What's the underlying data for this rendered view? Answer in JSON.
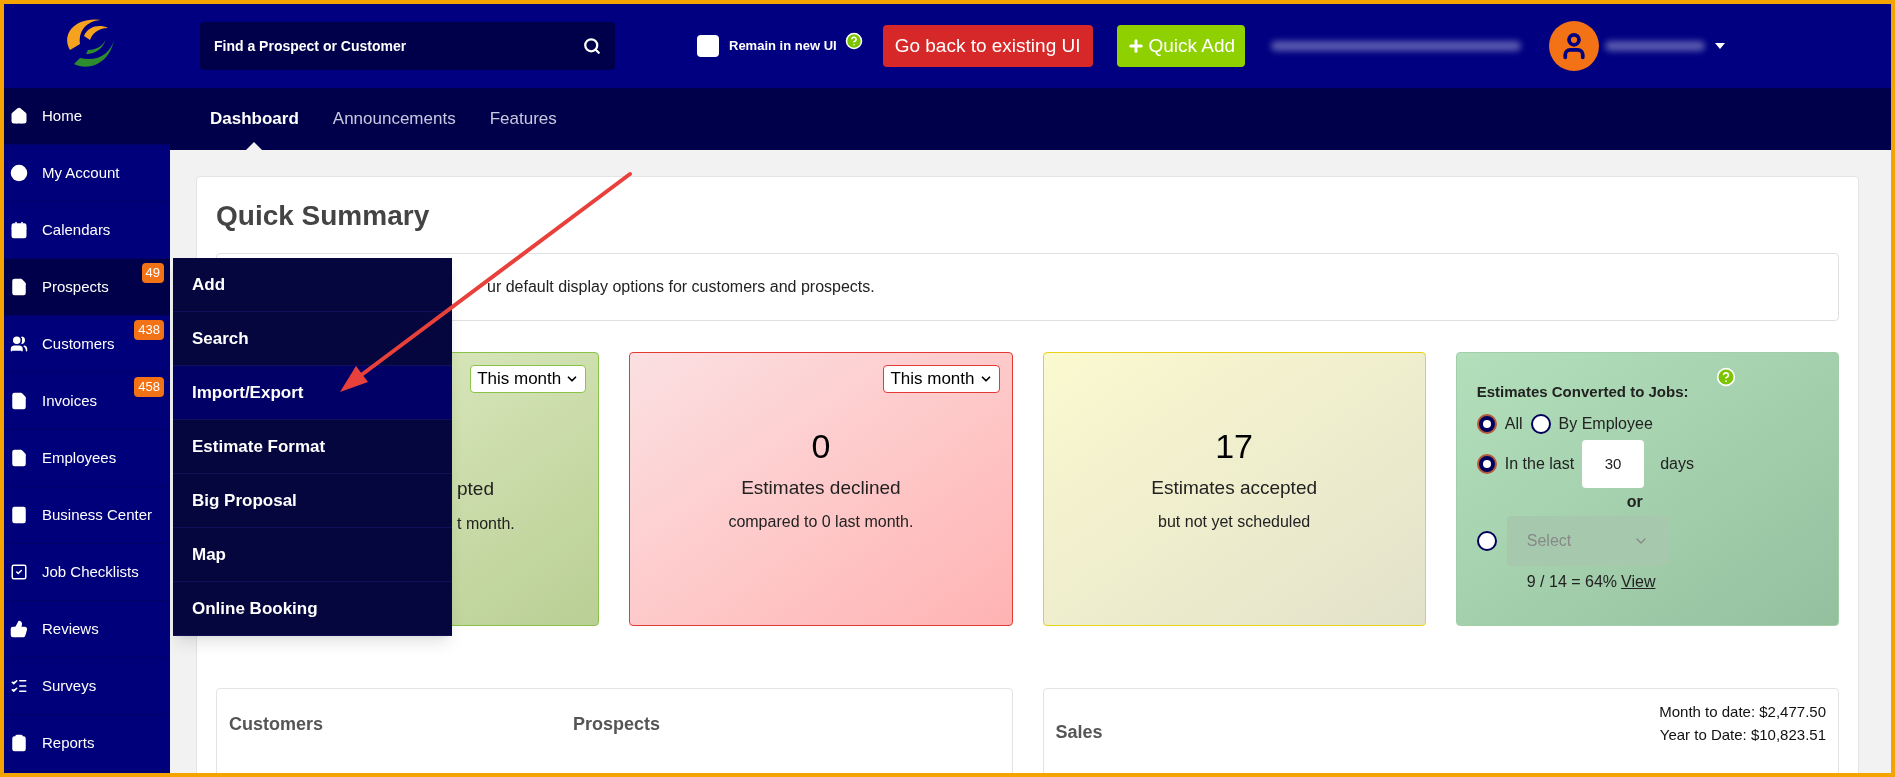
{
  "header": {
    "search": {
      "placeholder": "Find a Prospect or Customer"
    },
    "remain": {
      "label": "Remain in new UI",
      "checked": false
    },
    "back_button": "Go back to existing UI",
    "quick_add": "Quick Add"
  },
  "sidebar": {
    "items": [
      {
        "label": "Home",
        "selected": true
      },
      {
        "label": "My Account",
        "selected": false
      },
      {
        "label": "Calendars",
        "selected": false
      },
      {
        "label": "Prospects",
        "selected": true,
        "badge": "49"
      },
      {
        "label": "Customers",
        "selected": false,
        "badge": "438"
      },
      {
        "label": "Invoices",
        "selected": false,
        "badge": "458"
      },
      {
        "label": "Employees",
        "selected": false
      },
      {
        "label": "Business Center",
        "selected": false
      },
      {
        "label": "Job Checklists",
        "selected": false
      },
      {
        "label": "Reviews",
        "selected": false
      },
      {
        "label": "Surveys",
        "selected": false
      },
      {
        "label": "Reports",
        "selected": false
      }
    ]
  },
  "tabs": [
    {
      "label": "Dashboard",
      "selected": true
    },
    {
      "label": "Announcements",
      "selected": false
    },
    {
      "label": "Features",
      "selected": false
    }
  ],
  "menu": {
    "items": [
      {
        "label": "Add",
        "selected": false
      },
      {
        "label": "Search",
        "selected": false
      },
      {
        "label": "Import/Export",
        "selected": true
      },
      {
        "label": "Estimate Format",
        "selected": false
      },
      {
        "label": "Big Proposal",
        "selected": false
      },
      {
        "label": "Map",
        "selected": false
      },
      {
        "label": "Online Booking",
        "selected": false
      }
    ]
  },
  "summary": {
    "title": "Quick Summary",
    "notice": "ur default display options for customers and prospects.",
    "cards": [
      {
        "kind": "stat",
        "color": "#8bc34a",
        "period": "This month",
        "heading": "pted",
        "subtext": "t month."
      },
      {
        "kind": "stat",
        "color": "#e53935",
        "period": "This month",
        "number": "0",
        "heading": "Estimates declined",
        "subtext": "compared to 0 last month."
      },
      {
        "kind": "stat",
        "color": "#e6d31a",
        "number": "17",
        "heading": "Estimates accepted",
        "subtext": "but not yet scheduled"
      },
      {
        "kind": "conversion",
        "color": "#9fd0a8",
        "title": "Estimates Converted to Jobs:",
        "all": {
          "label": "All",
          "selected": true
        },
        "by_employee": {
          "label": "By Employee",
          "selected": false
        },
        "last": {
          "label": "In the last",
          "selected": true,
          "value": "30",
          "unit": "days"
        },
        "or": "or",
        "employee": {
          "selected": false,
          "placeholder": "Select"
        },
        "ratio": "9 / 14 = 64%",
        "link": "View"
      }
    ]
  },
  "bottom": {
    "customers": "Customers",
    "prospects": "Prospects",
    "sales": {
      "title": "Sales",
      "month": "Month to date: $2,477.50",
      "year": "Year to Date: $10,823.51"
    }
  }
}
